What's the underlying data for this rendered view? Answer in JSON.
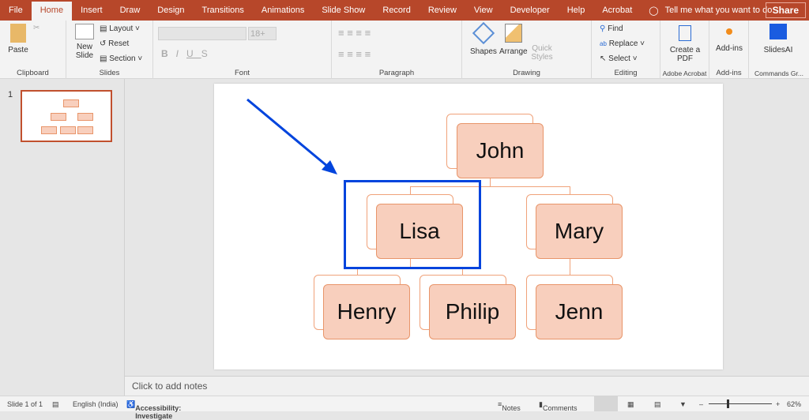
{
  "tabs": [
    "File",
    "Home",
    "Insert",
    "Draw",
    "Design",
    "Transitions",
    "Animations",
    "Slide Show",
    "Record",
    "Review",
    "View",
    "Developer",
    "Help",
    "Acrobat"
  ],
  "tell_me": "Tell me what you want to do",
  "share": "Share",
  "ribbon": {
    "clipboard": {
      "paste": "Paste",
      "label": "Clipboard"
    },
    "slides": {
      "new_slide": "New Slide",
      "layout": "Layout",
      "reset": "Reset",
      "section": "Section",
      "label": "Slides"
    },
    "font": {
      "size": "18+",
      "label": "Font"
    },
    "paragraph": {
      "label": "Paragraph"
    },
    "drawing": {
      "shapes": "Shapes",
      "arrange": "Arrange",
      "quick_styles": "Quick Styles",
      "label": "Drawing"
    },
    "editing": {
      "find": "Find",
      "replace": "Replace",
      "select": "Select",
      "label": "Editing"
    },
    "acrobat": {
      "create": "Create a PDF",
      "label": "Adobe Acrobat"
    },
    "addins": {
      "btn": "Add-ins",
      "label": "Add-ins"
    },
    "slidesai": {
      "btn": "SlidesAI",
      "label": "Commands Gr..."
    }
  },
  "thumb": {
    "number": "1"
  },
  "org": {
    "root": "John",
    "level2": [
      "Lisa",
      "Mary"
    ],
    "level3": [
      "Henry",
      "Philip",
      "Jenn"
    ]
  },
  "notes_placeholder": "Click to add notes",
  "status": {
    "slide": "Slide 1 of 1",
    "language": "English (India)",
    "accessibility": "Accessibility: Investigate",
    "notes": "Notes",
    "comments": "Comments",
    "zoom": "62%"
  },
  "colors": {
    "accent": "#b7472a",
    "node_fill": "#f8cfbd",
    "highlight": "#0044dd"
  }
}
